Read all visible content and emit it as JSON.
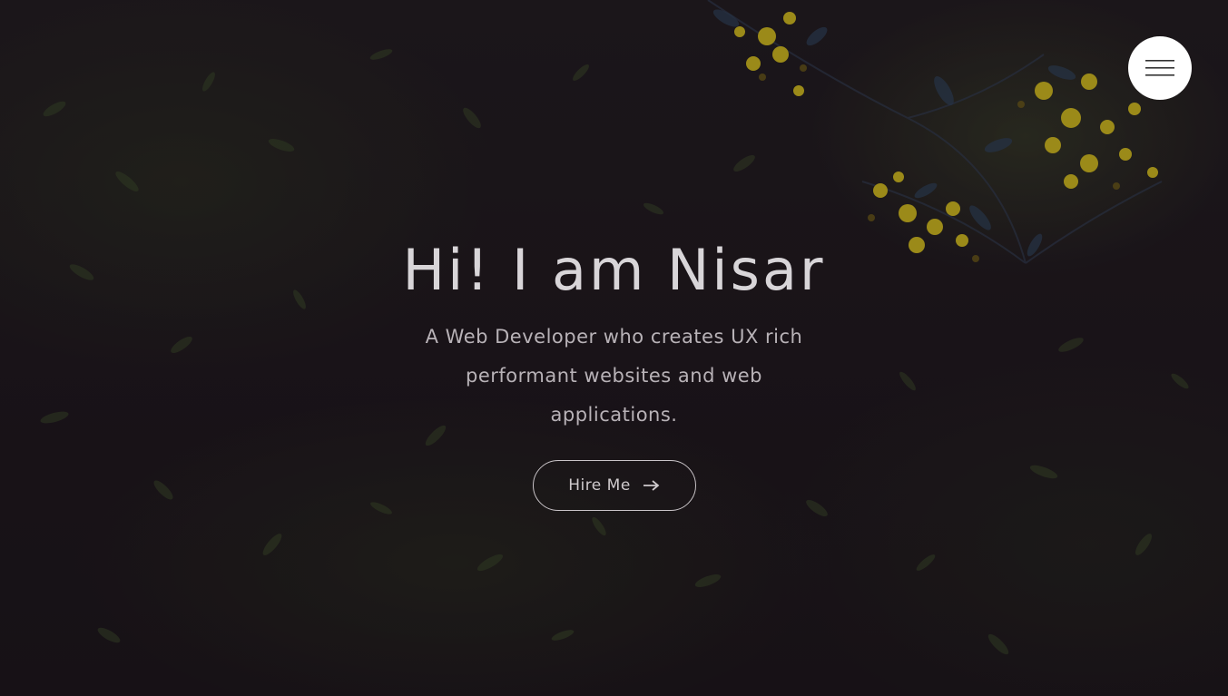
{
  "hero": {
    "title": "Hi! I am Nisar",
    "subtitle": "A Web Developer who creates UX rich performant websites and web applications.",
    "cta_label": "Hire Me",
    "cta_icon": "arrow-right-icon"
  },
  "nav": {
    "menu_icon": "hamburger-menu-icon"
  },
  "colors": {
    "text_primary": "#d8d5d8",
    "text_secondary": "#b8b2b7",
    "background": "#1a1417",
    "flower_accent": "#d4c21e",
    "menu_button_bg": "#ffffff"
  }
}
